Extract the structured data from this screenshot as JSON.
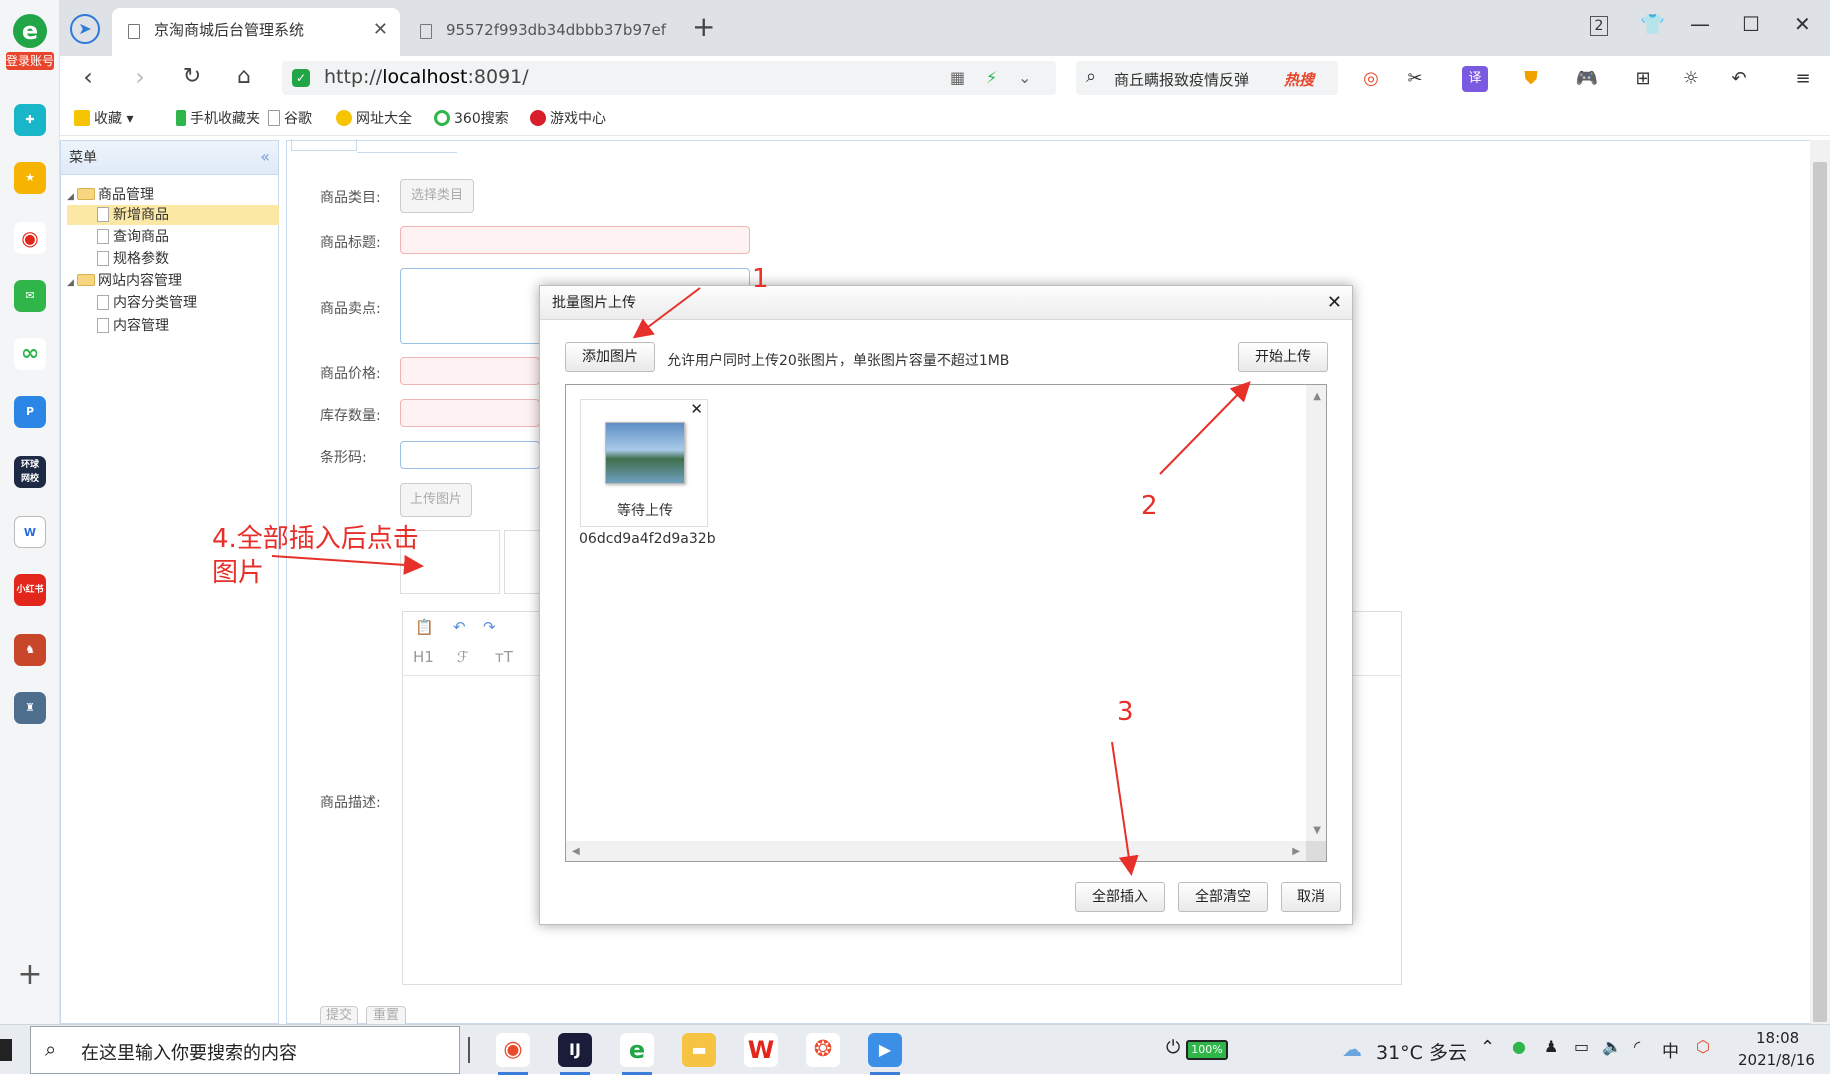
{
  "browser": {
    "tabs": [
      {
        "title": "京淘商城后台管理系统"
      },
      {
        "title": "95572f993db34dbbb37b97ef"
      }
    ],
    "address": {
      "scheme": "http://",
      "host": "localhost",
      "port": ":8091/"
    },
    "search": {
      "query": "商丘瞒报致疫情反弹",
      "hot": "热搜"
    },
    "bookmarks": [
      "收藏",
      "手机收藏夹",
      "谷歌",
      "网址大全",
      "360搜索",
      "游戏中心"
    ],
    "login_label": "登录账号"
  },
  "sidebar": {
    "title": "菜单",
    "tree": [
      {
        "label": "商品管理",
        "type": "folder"
      },
      {
        "label": "新增商品",
        "type": "file",
        "selected": true
      },
      {
        "label": "查询商品",
        "type": "file"
      },
      {
        "label": "规格参数",
        "type": "file"
      },
      {
        "label": "网站内容管理",
        "type": "folder"
      },
      {
        "label": "内容分类管理",
        "type": "file"
      },
      {
        "label": "内容管理",
        "type": "file"
      }
    ]
  },
  "form": {
    "category_label": "商品类目:",
    "category_button": "选择类目",
    "title_label": "商品标题:",
    "sellpoint_label": "商品卖点:",
    "price_label": "商品价格:",
    "stock_label": "库存数量:",
    "barcode_label": "条形码:",
    "upload_button": "上传图片",
    "desc_label": "商品描述:",
    "editor_toolbar": [
      "H1",
      "ℱ",
      "тT"
    ],
    "submit_button": "提交",
    "reset_button": "重置"
  },
  "dialog": {
    "title": "批量图片上传",
    "add_button": "添加图片",
    "hint": "允许用户同时上传20张图片，单张图片容量不超过1MB",
    "start_button": "开始上传",
    "file": {
      "status": "等待上传",
      "name": "06dcd9a4f2d9a32b"
    },
    "insert_all_button": "全部插入",
    "clear_all_button": "全部清空",
    "cancel_button": "取消"
  },
  "annotations": {
    "a1": "1",
    "a2": "2",
    "a3": "3",
    "a4_line1": "4.全部插入后点击",
    "a4_line2": "图片"
  },
  "taskbar": {
    "search_placeholder": "在这里输入你要搜索的内容",
    "battery": "100%",
    "weather": "31°C  多云",
    "ime": "中",
    "time": "18:08",
    "date": "2021/8/16"
  },
  "colors": {
    "annotation": "#e8302b",
    "accent": "#2f7ad8",
    "selected": "#fbe8a4"
  }
}
